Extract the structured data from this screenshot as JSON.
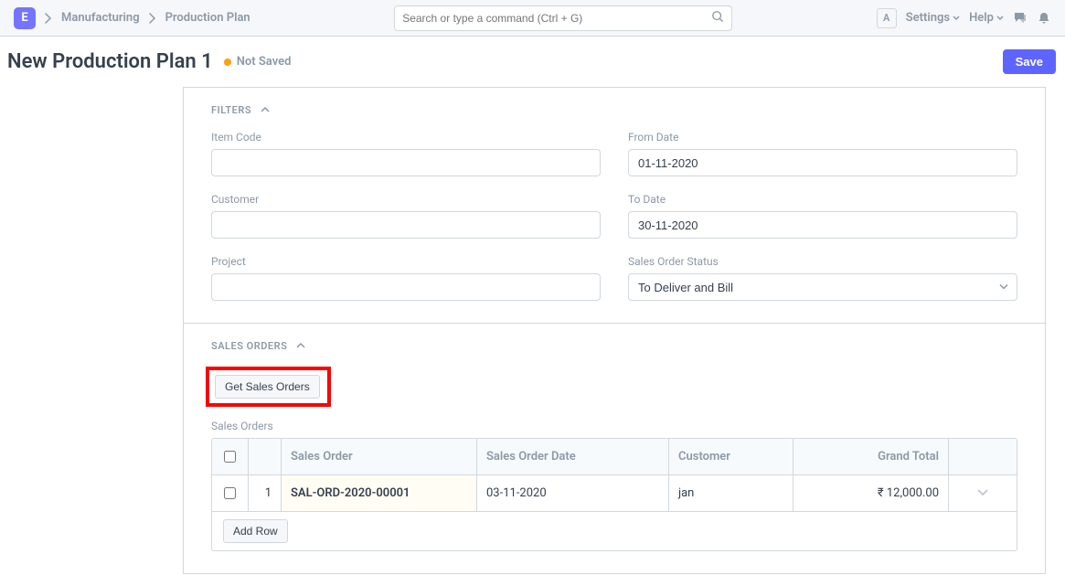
{
  "navbar": {
    "logo": "E",
    "breadcrumbs": [
      "Manufacturing",
      "Production Plan"
    ],
    "search_placeholder": "Search or type a command (Ctrl + G)",
    "avatar_initial": "A",
    "settings_label": "Settings",
    "help_label": "Help"
  },
  "page": {
    "title": "New Production Plan 1",
    "status": "Not Saved",
    "save_button": "Save"
  },
  "sections": {
    "filters": {
      "heading": "FILTERS",
      "item_code": {
        "label": "Item Code",
        "value": ""
      },
      "customer": {
        "label": "Customer",
        "value": ""
      },
      "project": {
        "label": "Project",
        "value": ""
      },
      "from_date": {
        "label": "From Date",
        "value": "01-11-2020"
      },
      "to_date": {
        "label": "To Date",
        "value": "30-11-2020"
      },
      "so_status": {
        "label": "Sales Order Status",
        "value": "To Deliver and Bill"
      }
    },
    "sales_orders": {
      "heading": "SALES ORDERS",
      "get_button": "Get Sales Orders",
      "table_label": "Sales Orders",
      "columns": {
        "sales_order": "Sales Order",
        "sales_order_date": "Sales Order Date",
        "customer": "Customer",
        "grand_total": "Grand Total"
      },
      "rows": [
        {
          "idx": "1",
          "sales_order": "SAL-ORD-2020-00001",
          "sales_order_date": "03-11-2020",
          "customer": "jan",
          "grand_total": "₹ 12,000.00"
        }
      ],
      "add_row": "Add Row"
    }
  }
}
